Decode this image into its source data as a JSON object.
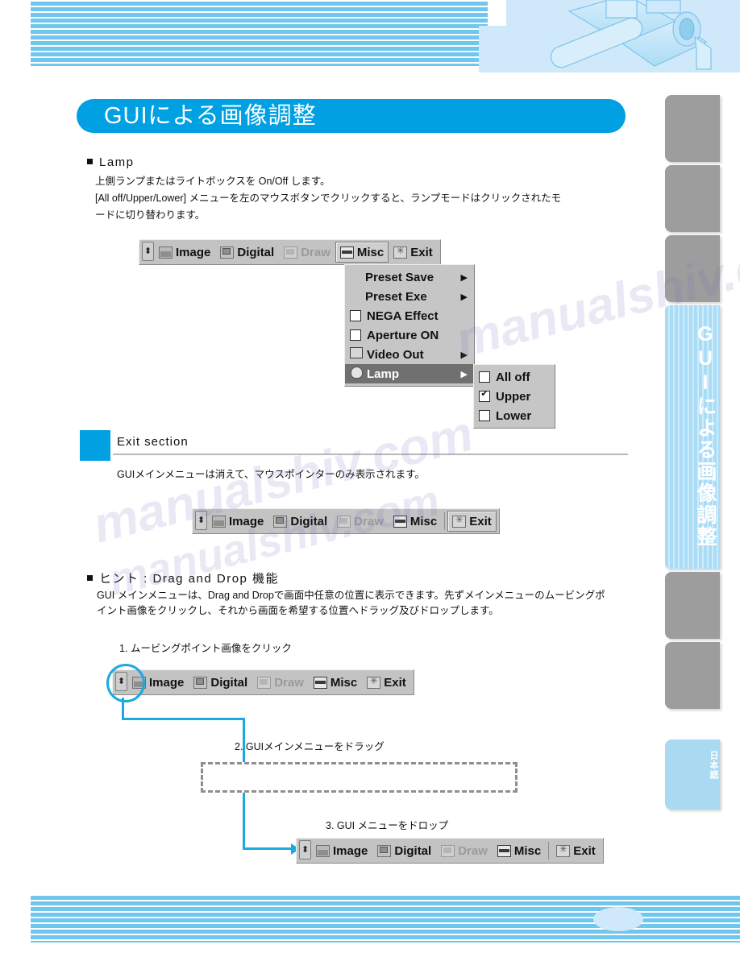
{
  "page": {
    "title": "GUIによる画像調整",
    "watermark": "manualshiv.com"
  },
  "sidebar": {
    "tabs": [
      {
        "label": "",
        "state": "inactive"
      },
      {
        "label": "",
        "state": "inactive"
      },
      {
        "label": "",
        "state": "inactive"
      },
      {
        "label": "GUIによる画像調整",
        "state": "active"
      },
      {
        "label": "",
        "state": "inactive"
      },
      {
        "label": "",
        "state": "inactive"
      },
      {
        "label": "日本語",
        "state": "language"
      }
    ]
  },
  "sections": {
    "lamp": {
      "heading": "Lamp",
      "line1": "上側ランプまたはライトボックスを On/Off します。",
      "line2": "[All off/Upper/Lower] メニューを左のマウスボタンでクリックすると、ランプモードはクリックされたモ",
      "line3": "ードに切り替わります。"
    },
    "exit": {
      "heading": "Exit section",
      "body": "GUIメインメニューは消えて、マウスポインターのみ表示されます。"
    },
    "hint": {
      "heading": "ヒント : Drag and Drop 機能",
      "line1": "GUI メインメニューは、Drag and Dropで画面中任意の位置に表示できます。先ずメインメニューのムービングポ",
      "line2": "イント画像をクリックし、それから画面を希望する位置へドラッグ及びドロップします。",
      "step1": "1. ムービングポイント画像をクリック",
      "step2": "2. GUIメインメニューをドラッグ",
      "step3": "3. GUI メニューをドロップ"
    }
  },
  "toolbar": {
    "grip_icon": "moving-point-icon",
    "items": [
      {
        "label": "Image",
        "icon": "image-icon",
        "state": "normal"
      },
      {
        "label": "Digital",
        "icon": "digital-icon",
        "state": "normal"
      },
      {
        "label": "Draw",
        "icon": "draw-icon",
        "state": "disabled"
      },
      {
        "label": "Misc",
        "icon": "misc-icon",
        "state": "normal"
      },
      {
        "label": "Exit",
        "icon": "exit-icon",
        "state": "normal"
      }
    ]
  },
  "toolbar_misc_active": {
    "items": [
      {
        "label": "Image",
        "state": "normal"
      },
      {
        "label": "Digital",
        "state": "normal"
      },
      {
        "label": "Draw",
        "state": "disabled"
      },
      {
        "label": "Misc",
        "state": "pressed"
      },
      {
        "label": "Exit",
        "state": "normal"
      }
    ]
  },
  "toolbar_exit_active": {
    "items": [
      {
        "label": "Image",
        "state": "normal"
      },
      {
        "label": "Digital",
        "state": "normal"
      },
      {
        "label": "Draw",
        "state": "disabled"
      },
      {
        "label": "Misc",
        "state": "normal"
      },
      {
        "label": "Exit",
        "state": "pressed"
      }
    ]
  },
  "misc_menu": {
    "items": [
      {
        "label": "Preset Save",
        "type": "submenu",
        "arrow": "▶",
        "checked": false,
        "highlighted": false
      },
      {
        "label": "Preset Exe",
        "type": "submenu",
        "arrow": "▶",
        "checked": false,
        "highlighted": false
      },
      {
        "label": "NEGA Effect",
        "type": "checkbox",
        "arrow": "",
        "checked": false,
        "highlighted": false
      },
      {
        "label": "Aperture ON",
        "type": "checkbox",
        "arrow": "",
        "checked": false,
        "highlighted": false
      },
      {
        "label": "Video Out",
        "type": "submenu",
        "arrow": "▶",
        "checked": false,
        "highlighted": false,
        "icon": "video-out-icon"
      },
      {
        "label": "Lamp",
        "type": "submenu",
        "arrow": "▶",
        "checked": false,
        "highlighted": true,
        "icon": "lamp-icon"
      }
    ]
  },
  "lamp_submenu": {
    "items": [
      {
        "label": "All off",
        "checked": false
      },
      {
        "label": "Upper",
        "checked": true
      },
      {
        "label": "Lower",
        "checked": false
      }
    ]
  },
  "colors": {
    "accent_blue": "#00a0e3",
    "stripe_blue": "#6fc6ee",
    "tab_gray": "#9d9d9d",
    "menu_gray": "#c6c6c6",
    "highlight_gray": "#707070",
    "arrow_blue": "#1aa9e0"
  }
}
